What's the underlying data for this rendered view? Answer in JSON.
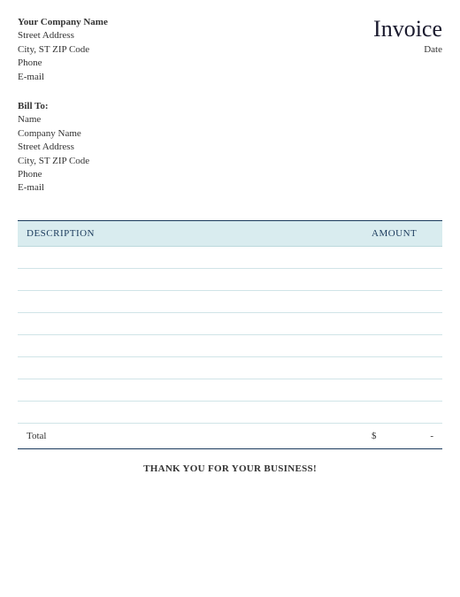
{
  "document": {
    "title": "Invoice",
    "date_label": "Date"
  },
  "company": {
    "name": "Your Company Name",
    "street": "Street Address",
    "citystzip": "City, ST  ZIP Code",
    "phone": "Phone",
    "email": "E-mail"
  },
  "billto": {
    "heading": "Bill To:",
    "name": "Name",
    "company": "Company Name",
    "street": "Street Address",
    "citystzip": "City, ST  ZIP Code",
    "phone": "Phone",
    "email": "E-mail"
  },
  "table": {
    "col_description": "DESCRIPTION",
    "col_amount": "AMOUNT",
    "rows": [
      {
        "description": "",
        "amount": ""
      },
      {
        "description": "",
        "amount": ""
      },
      {
        "description": "",
        "amount": ""
      },
      {
        "description": "",
        "amount": ""
      },
      {
        "description": "",
        "amount": ""
      },
      {
        "description": "",
        "amount": ""
      },
      {
        "description": "",
        "amount": ""
      },
      {
        "description": "",
        "amount": ""
      }
    ],
    "total_label": "Total",
    "total_currency": "$",
    "total_value": "-"
  },
  "footer": {
    "thanks": "THANK YOU FOR YOUR BUSINESS!"
  }
}
